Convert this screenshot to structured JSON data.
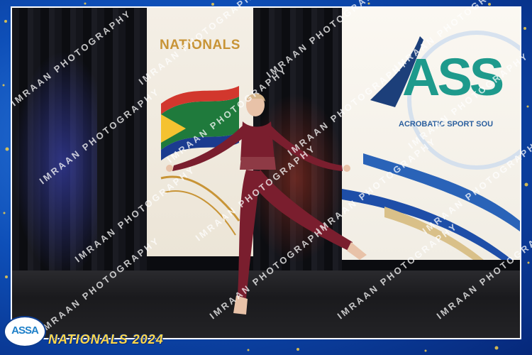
{
  "banner_left": {
    "title": "NATIONALS"
  },
  "banner_right": {
    "logo_text": "ASS",
    "subtitle": "ACROBATIC SPORT SOU"
  },
  "watermark": {
    "text": "IMRAAN PHOTOGRAPHY"
  },
  "footer": {
    "logo_text": "ASSA",
    "event_label": "NATIONALS 2024"
  },
  "colors": {
    "frame_blue": "#0e4fb8",
    "gold": "#c89436",
    "teal": "#1e9a8c",
    "costume": "#7a1e2e"
  }
}
